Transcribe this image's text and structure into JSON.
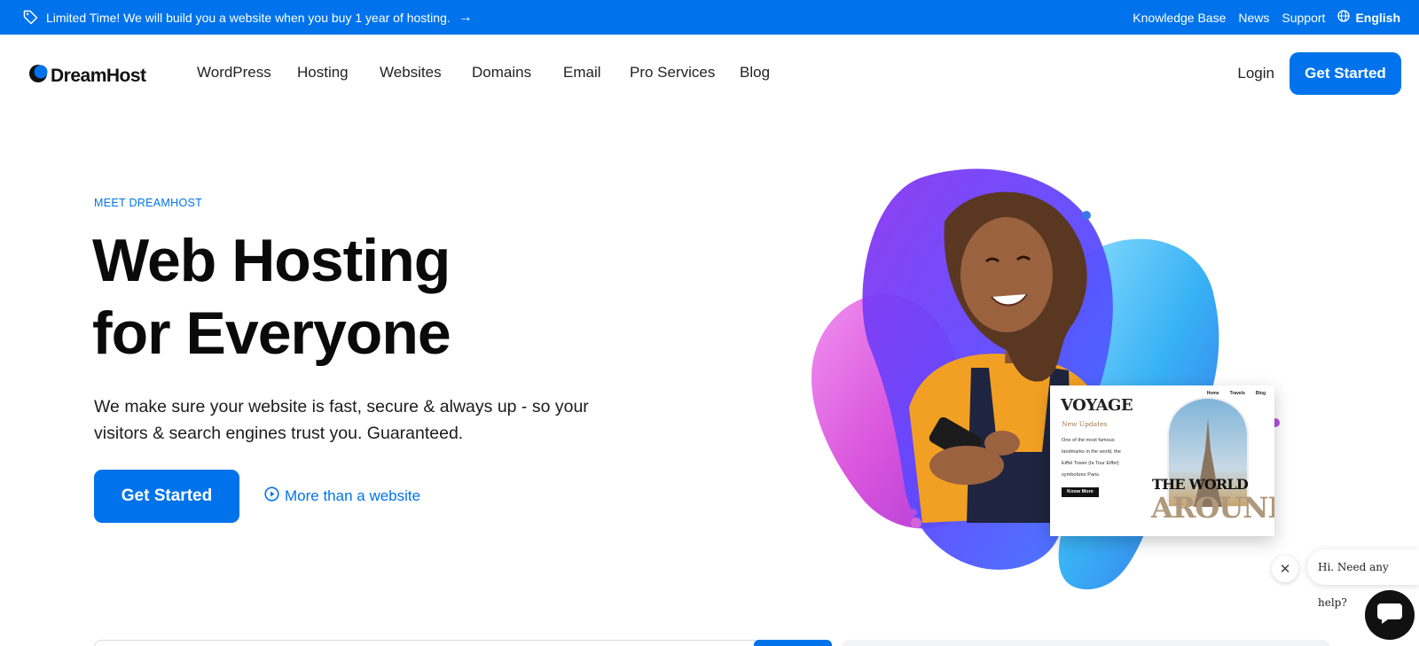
{
  "promo": {
    "text": "Limited Time! We will build you a website when you buy 1 year of hosting.",
    "arrow": "→"
  },
  "utility_nav": {
    "links": [
      "Knowledge Base",
      "News",
      "Support"
    ],
    "language": "English"
  },
  "header": {
    "logo_text": "DreamHost",
    "nav_items": [
      "WordPress",
      "Hosting",
      "Websites",
      "Domains",
      "Email",
      "Pro Services",
      "Blog"
    ],
    "login": "Login",
    "cta": "Get Started"
  },
  "hero": {
    "eyebrow": "MEET DREAMHOST",
    "title_line1": "Web Hosting",
    "title_line2": "for Everyone",
    "subtitle": "We make sure your website is fast, secure & always up - so your visitors & search engines trust you. Guaranteed.",
    "cta": "Get Started",
    "secondary_link": "More than a website"
  },
  "mockup": {
    "title": "VOYAGE",
    "subtitle": "New Updates",
    "body": "One of the most famous landmarks in the world, the Eiffel Tower (la Tour Eiffel) symbolizes Paris.",
    "button": "Know More",
    "nav": [
      "Home",
      "Travels",
      "Blog"
    ],
    "headline1": "THE WORLD",
    "headline2": "AROUND"
  },
  "chat": {
    "greeting": "Hi. Need any help?",
    "close_glyph": "✕"
  },
  "colors": {
    "brand_blue": "#0073ec",
    "text_dark": "#0a0a0a"
  }
}
